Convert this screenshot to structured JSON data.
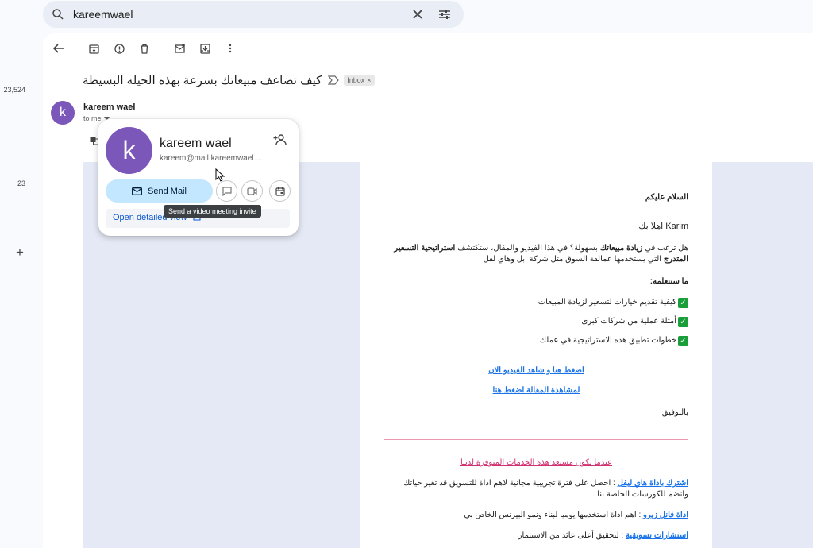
{
  "search": {
    "query": "kareemwael"
  },
  "rail": {
    "count_top": "23,524",
    "count_mid": "23",
    "plus": "+"
  },
  "message": {
    "subject": "كيف تضاعف مبيعاتك بسرعة بهذه الحيله البسيطة",
    "label": "Inbox",
    "sender_initial": "k",
    "sender_name": "kareem wael",
    "recipient": "to me"
  },
  "card": {
    "initial": "k",
    "name": "kareem wael",
    "email": "kareem@mail.kareemwael....",
    "send_label": "Send Mail",
    "open_label": "Open detailed view",
    "tooltip": "Send a video meeting invite"
  },
  "body": {
    "greeting": "السلام عليكم",
    "hello": "Karim اهلا بك",
    "intro_pre": "هل ترغب في ",
    "intro_bold1": "زيادة مبيعاتك",
    "intro_mid": " بسهولة؟ في هذا الفيديو والمقال، ستكتشف ",
    "intro_bold2": "استراتيجية التسعير المتدرج",
    "intro_post": " التي يستخدمها عمالقة السوق مثل شركة ابل وهاي لفل",
    "learn_title": "ما ستتعلمه:",
    "checks": [
      "كيفية تقديم خيارات لتسعير لزيادة المبيعات",
      "أمثلة عملية من شركات كبرى",
      "خطوات تطبيق هذه الاستراتيجية في عملك"
    ],
    "check_mark": "✓",
    "link1": "اضغط هنا و شاهد الفيديو الان",
    "link2": "لمشاهدة المقالة اضغط هنا",
    "thanks": "بالتوفيق",
    "services_title": "عندما تكون مستعد هذه الخدمات المتوفرة لدينا",
    "svc1_link": "اشترك باداة هاي ليفل",
    "svc1_text": " : احصل على فترة تجريبية مجانية لاهم اداة للتسويق قد تغير حياتك وانضم للكورسات الخاصة بنا",
    "svc2_link": "اداة فانل زيرو",
    "svc2_text": " : اهم اداة استخدمها يوميا لبناء ونمو البيزنس الخاص بي",
    "svc3_link": "استشارات تسويقية",
    "svc3_text": " : لتحقيق أعلى عائد من الاستثمار"
  },
  "colors": {
    "avatar": "#7b57b9",
    "send_button": "#c2e7ff",
    "link": "#1a73e8",
    "accent_pink": "#d0306e"
  },
  "icons": [
    "search-icon",
    "close-icon",
    "filter-icon",
    "back-icon",
    "archive-icon",
    "report-icon",
    "delete-icon",
    "mark-unread-icon",
    "move-icon",
    "more-icon",
    "important-icon",
    "add-person-icon",
    "mail-icon",
    "chat-icon",
    "video-icon",
    "calendar-icon",
    "external-link-icon"
  ]
}
